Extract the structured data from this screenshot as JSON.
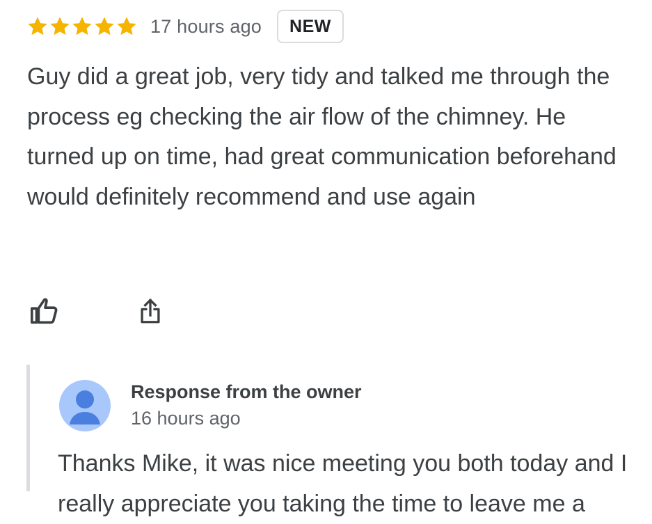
{
  "review": {
    "rating": 5,
    "rating_max": 5,
    "star_color": "#f5b400",
    "time": "17 hours ago",
    "badge": "NEW",
    "text": "Guy did a great job, very tidy and talked me through the process eg checking the air flow of the chimney. He turned up on time, had great communication beforehand would definitely recommend and use again"
  },
  "actions": {
    "like_icon": "thumbs-up-icon",
    "share_icon": "share-icon"
  },
  "owner_response": {
    "avatar_icon": "person-icon",
    "avatar_color": "#a8c7fa",
    "avatar_figure_color": "#4a7fe0",
    "title": "Response from the owner",
    "time": "16 hours ago",
    "text": "Thanks Mike, it was nice meeting you both today and I really appreciate you taking the time to leave me a"
  }
}
